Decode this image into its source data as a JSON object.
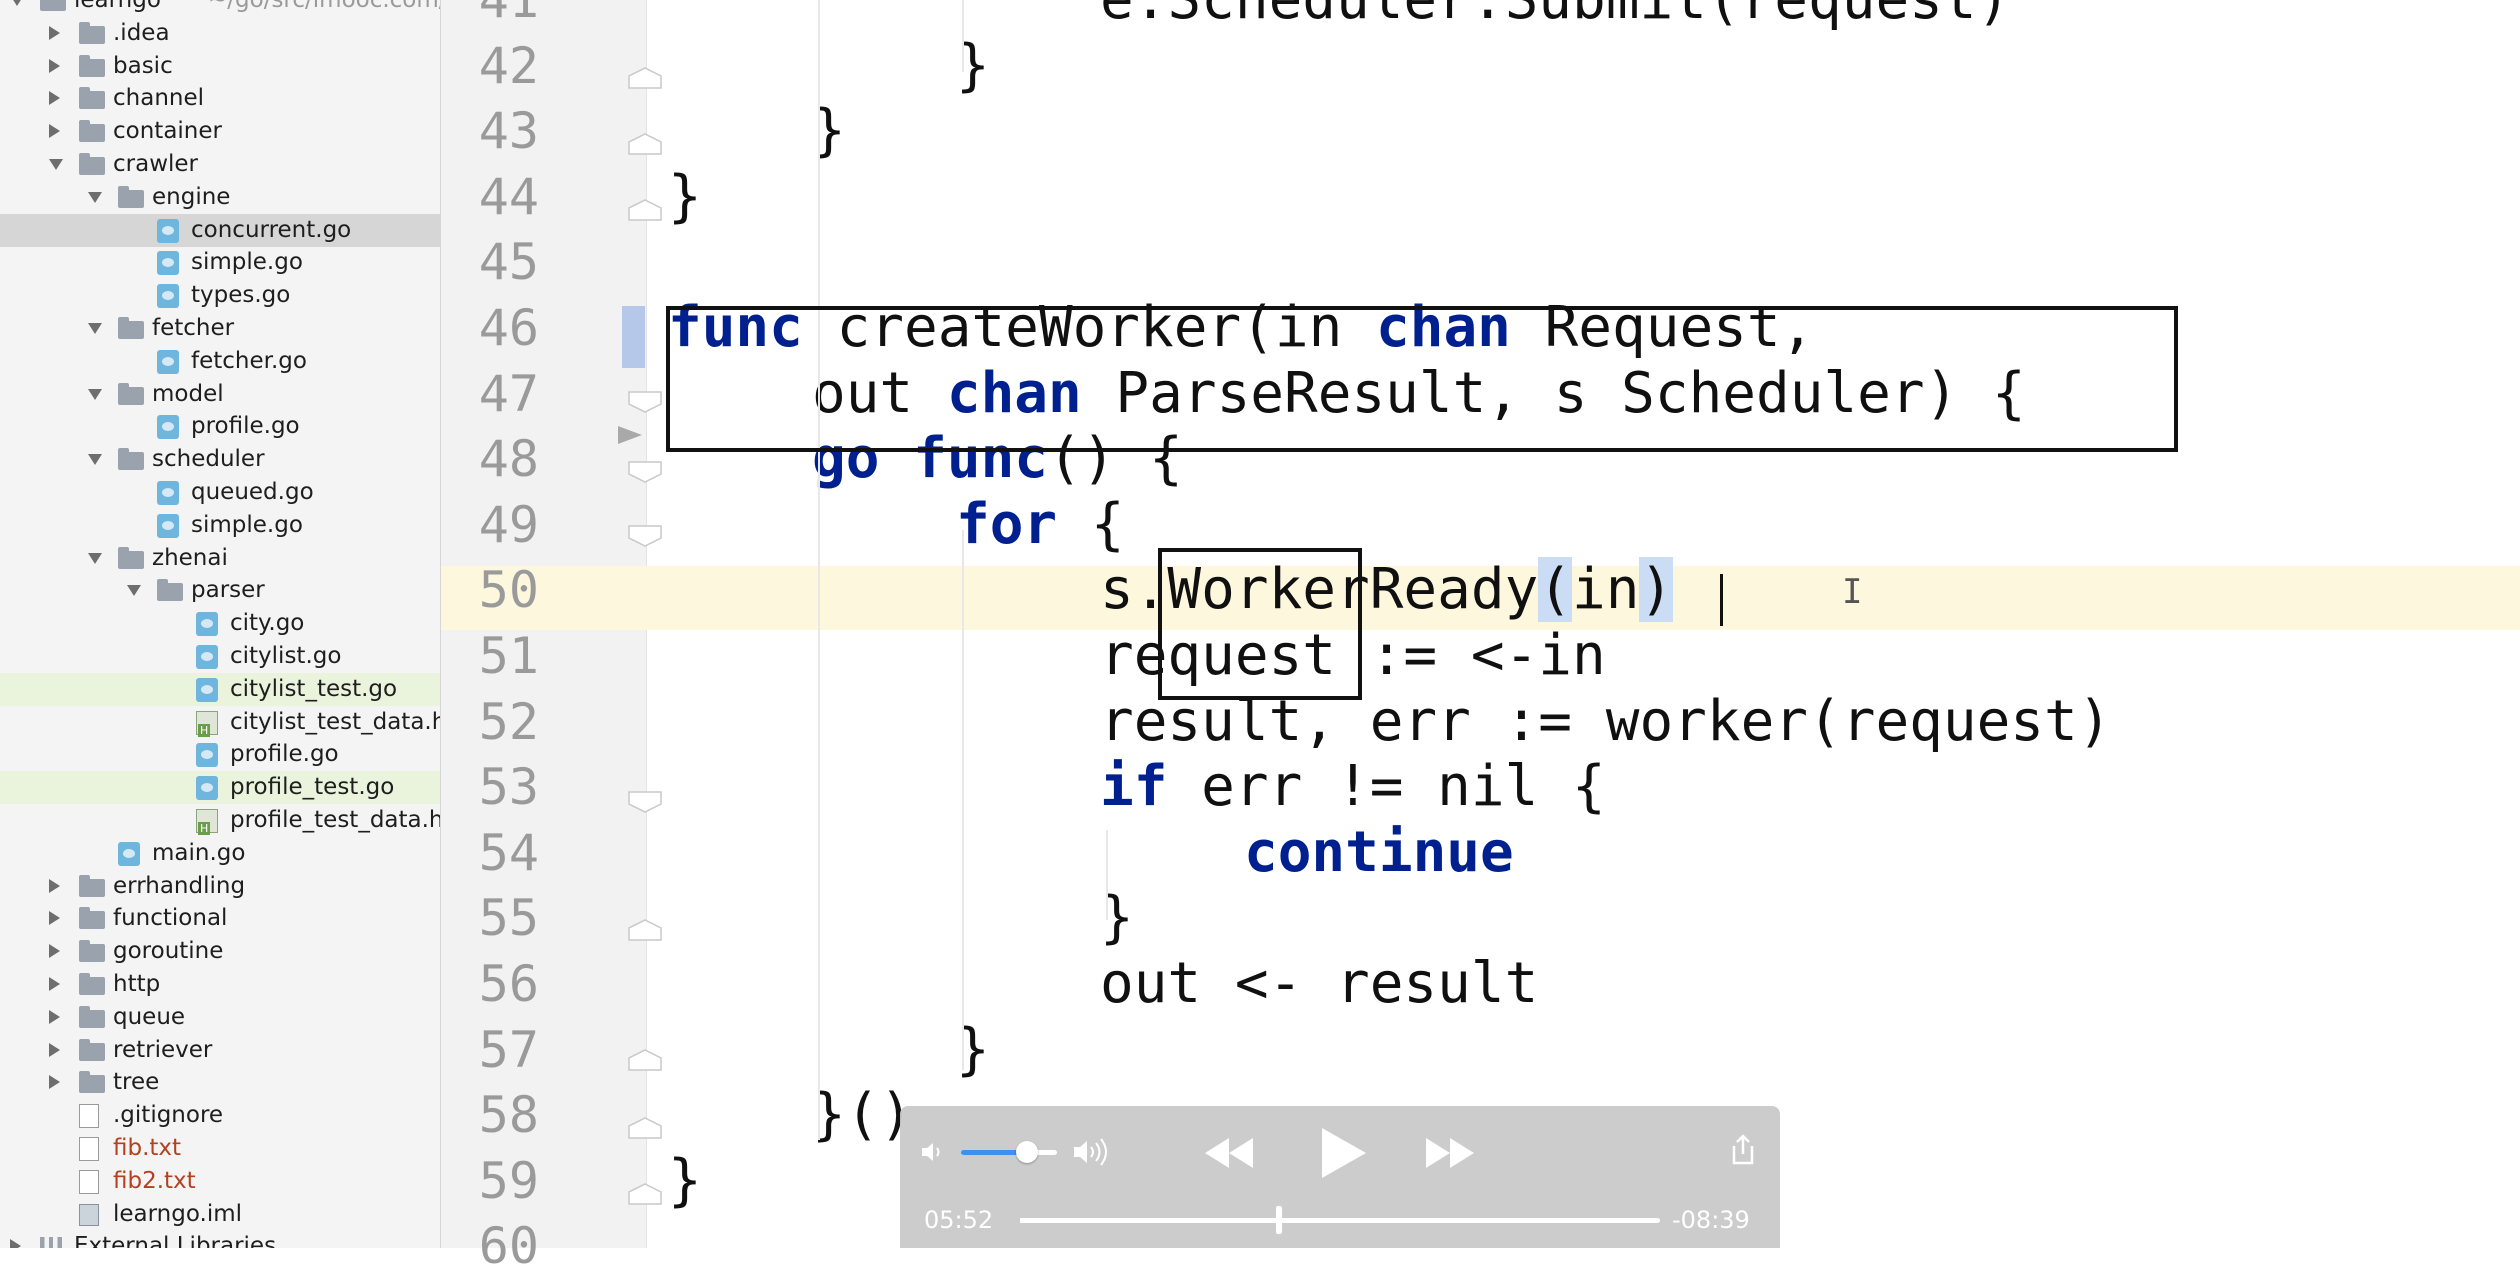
{
  "project_tree": {
    "items": [
      {
        "label": "learngo",
        "suffix": "~/go/src/imooc.com/c",
        "kind": "module",
        "depth": 0,
        "expanded": true,
        "state": ""
      },
      {
        "label": ".idea",
        "kind": "folder",
        "depth": 1,
        "expanded": false,
        "state": ""
      },
      {
        "label": "basic",
        "kind": "folder",
        "depth": 1,
        "expanded": false,
        "state": ""
      },
      {
        "label": "channel",
        "kind": "folder",
        "depth": 1,
        "expanded": false,
        "state": ""
      },
      {
        "label": "container",
        "kind": "folder",
        "depth": 1,
        "expanded": false,
        "state": ""
      },
      {
        "label": "crawler",
        "kind": "folder",
        "depth": 1,
        "expanded": true,
        "state": ""
      },
      {
        "label": "engine",
        "kind": "folder",
        "depth": 2,
        "expanded": true,
        "state": ""
      },
      {
        "label": "concurrent.go",
        "kind": "go",
        "depth": 3,
        "state": "selected"
      },
      {
        "label": "simple.go",
        "kind": "go",
        "depth": 3,
        "state": ""
      },
      {
        "label": "types.go",
        "kind": "go",
        "depth": 3,
        "state": ""
      },
      {
        "label": "fetcher",
        "kind": "folder",
        "depth": 2,
        "expanded": true,
        "state": ""
      },
      {
        "label": "fetcher.go",
        "kind": "go",
        "depth": 3,
        "state": ""
      },
      {
        "label": "model",
        "kind": "folder",
        "depth": 2,
        "expanded": true,
        "state": ""
      },
      {
        "label": "profile.go",
        "kind": "go",
        "depth": 3,
        "state": ""
      },
      {
        "label": "scheduler",
        "kind": "folder",
        "depth": 2,
        "expanded": true,
        "state": ""
      },
      {
        "label": "queued.go",
        "kind": "go",
        "depth": 3,
        "state": ""
      },
      {
        "label": "simple.go",
        "kind": "go",
        "depth": 3,
        "state": ""
      },
      {
        "label": "zhenai",
        "kind": "folder",
        "depth": 2,
        "expanded": true,
        "state": ""
      },
      {
        "label": "parser",
        "kind": "folder",
        "depth": 3,
        "expanded": true,
        "state": ""
      },
      {
        "label": "city.go",
        "kind": "go",
        "depth": 4,
        "state": ""
      },
      {
        "label": "citylist.go",
        "kind": "go",
        "depth": 4,
        "state": ""
      },
      {
        "label": "citylist_test.go",
        "kind": "go",
        "depth": 4,
        "state": "modified"
      },
      {
        "label": "citylist_test_data.html",
        "kind": "html",
        "depth": 4,
        "state": ""
      },
      {
        "label": "profile.go",
        "kind": "go",
        "depth": 4,
        "state": ""
      },
      {
        "label": "profile_test.go",
        "kind": "go",
        "depth": 4,
        "state": "modified"
      },
      {
        "label": "profile_test_data.html",
        "kind": "html",
        "depth": 4,
        "state": ""
      },
      {
        "label": "main.go",
        "kind": "go",
        "depth": 2,
        "state": ""
      },
      {
        "label": "errhandling",
        "kind": "folder",
        "depth": 1,
        "expanded": false,
        "state": ""
      },
      {
        "label": "functional",
        "kind": "folder",
        "depth": 1,
        "expanded": false,
        "state": ""
      },
      {
        "label": "goroutine",
        "kind": "folder",
        "depth": 1,
        "expanded": false,
        "state": ""
      },
      {
        "label": "http",
        "kind": "folder",
        "depth": 1,
        "expanded": false,
        "state": ""
      },
      {
        "label": "queue",
        "kind": "folder",
        "depth": 1,
        "expanded": false,
        "state": ""
      },
      {
        "label": "retriever",
        "kind": "folder",
        "depth": 1,
        "expanded": false,
        "state": ""
      },
      {
        "label": "tree",
        "kind": "folder",
        "depth": 1,
        "expanded": false,
        "state": ""
      },
      {
        "label": ".gitignore",
        "kind": "text",
        "depth": 1,
        "state": ""
      },
      {
        "label": "fib.txt",
        "kind": "text",
        "depth": 1,
        "state": "untracked"
      },
      {
        "label": "fib2.txt",
        "kind": "text",
        "depth": 1,
        "state": "untracked"
      },
      {
        "label": "learngo.iml",
        "kind": "module-file",
        "depth": 1,
        "state": ""
      },
      {
        "label": "External Libraries",
        "kind": "library",
        "depth": 0,
        "expanded": false,
        "state": ""
      }
    ]
  },
  "editor": {
    "file": "concurrent.go",
    "current_line": "50",
    "lines": [
      {
        "num": "41",
        "indent": 3,
        "tokens": [
          {
            "t": "e.Scheduler.Submit(request)"
          }
        ]
      },
      {
        "num": "42",
        "indent": 2,
        "tokens": [
          {
            "t": "}"
          }
        ]
      },
      {
        "num": "43",
        "indent": 1,
        "tokens": [
          {
            "t": "}"
          }
        ]
      },
      {
        "num": "44",
        "indent": 0,
        "tokens": [
          {
            "t": "}"
          }
        ]
      },
      {
        "num": "45",
        "indent": 0,
        "tokens": []
      },
      {
        "num": "46",
        "indent": 0,
        "tokens": [
          {
            "t": "func",
            "kw": true
          },
          {
            "t": " createWorker(in "
          },
          {
            "t": "chan",
            "kw": true
          },
          {
            "t": " Request,"
          }
        ]
      },
      {
        "num": "47",
        "indent": 1,
        "tokens": [
          {
            "t": "out "
          },
          {
            "t": "chan",
            "kw": true
          },
          {
            "t": " ParseResult, s Scheduler) {"
          }
        ]
      },
      {
        "num": "48",
        "indent": 1,
        "tokens": [
          {
            "t": "go",
            "kw": true
          },
          {
            "t": " "
          },
          {
            "t": "func",
            "kw": true
          },
          {
            "t": "() {"
          }
        ]
      },
      {
        "num": "49",
        "indent": 2,
        "tokens": [
          {
            "t": "for",
            "kw": true
          },
          {
            "t": " {"
          }
        ]
      },
      {
        "num": "50",
        "indent": 3,
        "tokens": [
          {
            "t": "s.WorkerReady"
          },
          {
            "t": "(",
            "hl": true
          },
          {
            "t": "in"
          },
          {
            "t": ")",
            "hl": true
          }
        ]
      },
      {
        "num": "51",
        "indent": 3,
        "tokens": [
          {
            "t": "request := <-in"
          }
        ]
      },
      {
        "num": "52",
        "indent": 3,
        "tokens": [
          {
            "t": "result, err := worker(request)"
          }
        ]
      },
      {
        "num": "53",
        "indent": 3,
        "tokens": [
          {
            "t": "if",
            "kw": true
          },
          {
            "t": " err != nil {"
          }
        ]
      },
      {
        "num": "54",
        "indent": 4,
        "tokens": [
          {
            "t": "continue",
            "kw": true
          }
        ]
      },
      {
        "num": "55",
        "indent": 3,
        "tokens": [
          {
            "t": "}"
          }
        ]
      },
      {
        "num": "56",
        "indent": 3,
        "tokens": [
          {
            "t": "out <- result"
          }
        ]
      },
      {
        "num": "57",
        "indent": 2,
        "tokens": [
          {
            "t": "}"
          }
        ]
      },
      {
        "num": "58",
        "indent": 1,
        "tokens": [
          {
            "t": "}()"
          }
        ]
      },
      {
        "num": "59",
        "indent": 0,
        "tokens": [
          {
            "t": "}"
          }
        ]
      },
      {
        "num": "60",
        "indent": 0,
        "tokens": []
      }
    ]
  },
  "video_player": {
    "elapsed": "05:52",
    "remaining": "-08:39",
    "progress": 0.404,
    "volume": 0.69,
    "icons": [
      "volume-low-icon",
      "volume-high-icon",
      "rewind-icon",
      "play-icon",
      "fast-forward-icon",
      "share-icon"
    ]
  },
  "colors": {
    "keyword": "#00208f",
    "current_line": "#fdf7dd",
    "selected_row": "#d6d6d6",
    "modified_row": "#eaf4dd",
    "volume_accent": "#3f8ef0"
  }
}
